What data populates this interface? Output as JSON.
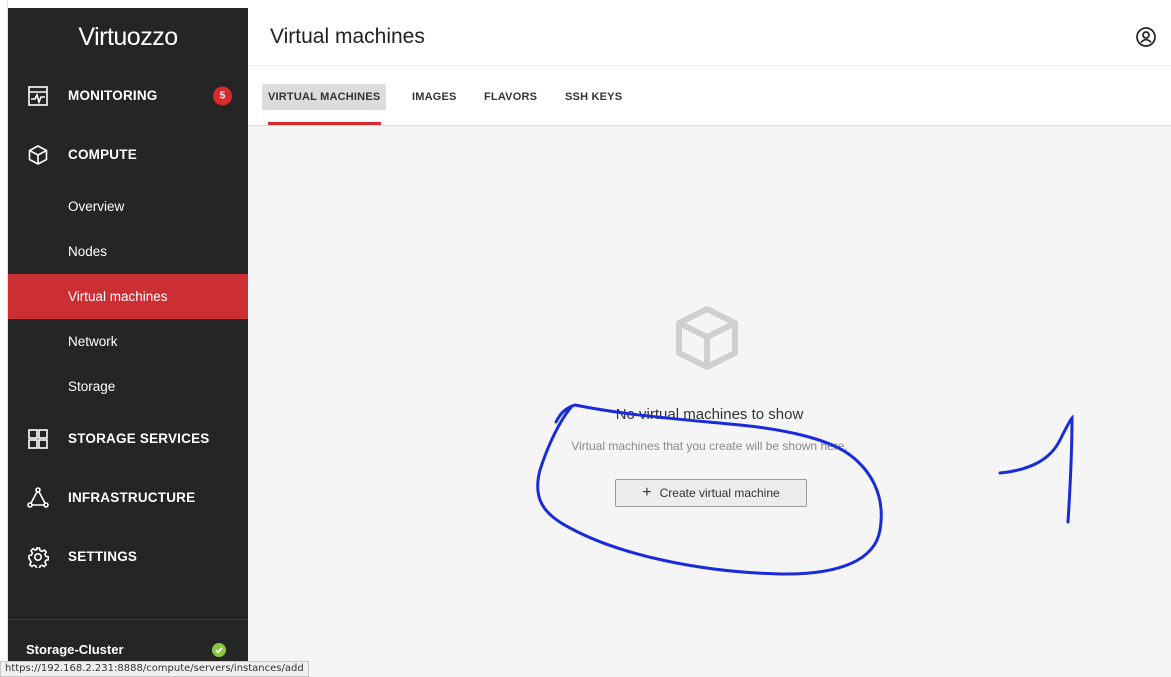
{
  "app": {
    "logo_text": "Virtuozzo"
  },
  "sidebar": {
    "sections": [
      {
        "label": "MONITORING",
        "badge": "5"
      },
      {
        "label": "COMPUTE"
      },
      {
        "label": "STORAGE SERVICES"
      },
      {
        "label": "INFRASTRUCTURE"
      },
      {
        "label": "SETTINGS"
      }
    ],
    "compute_items": [
      {
        "label": "Overview"
      },
      {
        "label": "Nodes"
      },
      {
        "label": "Virtual machines",
        "active": true
      },
      {
        "label": "Network"
      },
      {
        "label": "Storage"
      }
    ],
    "footer": {
      "cluster_name": "Storage-Cluster",
      "status": "ok"
    }
  },
  "header": {
    "title": "Virtual machines"
  },
  "tabs": [
    {
      "label": "VIRTUAL MACHINES",
      "active": true
    },
    {
      "label": "IMAGES"
    },
    {
      "label": "FLAVORS"
    },
    {
      "label": "SSH KEYS"
    }
  ],
  "empty_state": {
    "title": "No virtual machines to show",
    "description": "Virtual machines that you create will be shown here.",
    "button_label": "Create virtual machine"
  },
  "status_bar": {
    "url": "https://192.168.2.231:8888/compute/servers/instances/add"
  },
  "colors": {
    "sidebar_bg": "#252525",
    "accent_red": "#d8292f",
    "active_item_bg": "#cc2f33",
    "ok_green": "#8ac53e",
    "annotation_blue": "#1a2bdc"
  }
}
